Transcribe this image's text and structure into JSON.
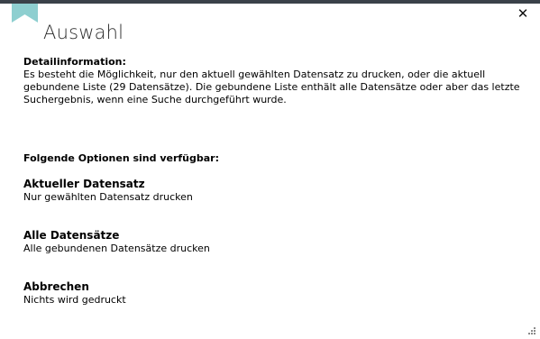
{
  "dialog": {
    "title": "Auswahl",
    "close_symbol": "✕",
    "close_icon": "close-icon",
    "bookmark_icon": "bookmark-icon",
    "accent_color": "#8ecfd0",
    "topbar_color": "#3a4149"
  },
  "detail": {
    "heading": "Detailinformation:",
    "text": "Es besteht die Möglichkeit, nur den aktuell gewählten Datensatz zu drucken, oder die aktuell gebundene Liste (29 Datensätze). Die gebundene Liste enthält alle Datensätze oder aber das letzte Suchergebnis, wenn eine Suche durchgeführt wurde."
  },
  "options": {
    "heading": "Folgende Optionen sind verfügbar:",
    "items": [
      {
        "title": "Aktueller Datensatz",
        "subtitle": "Nur gewählten Datensatz drucken"
      },
      {
        "title": "Alle Datensätze",
        "subtitle": "Alle gebundenen Datensätze drucken"
      },
      {
        "title": "Abbrechen",
        "subtitle": "Nichts wird gedruckt"
      }
    ]
  }
}
